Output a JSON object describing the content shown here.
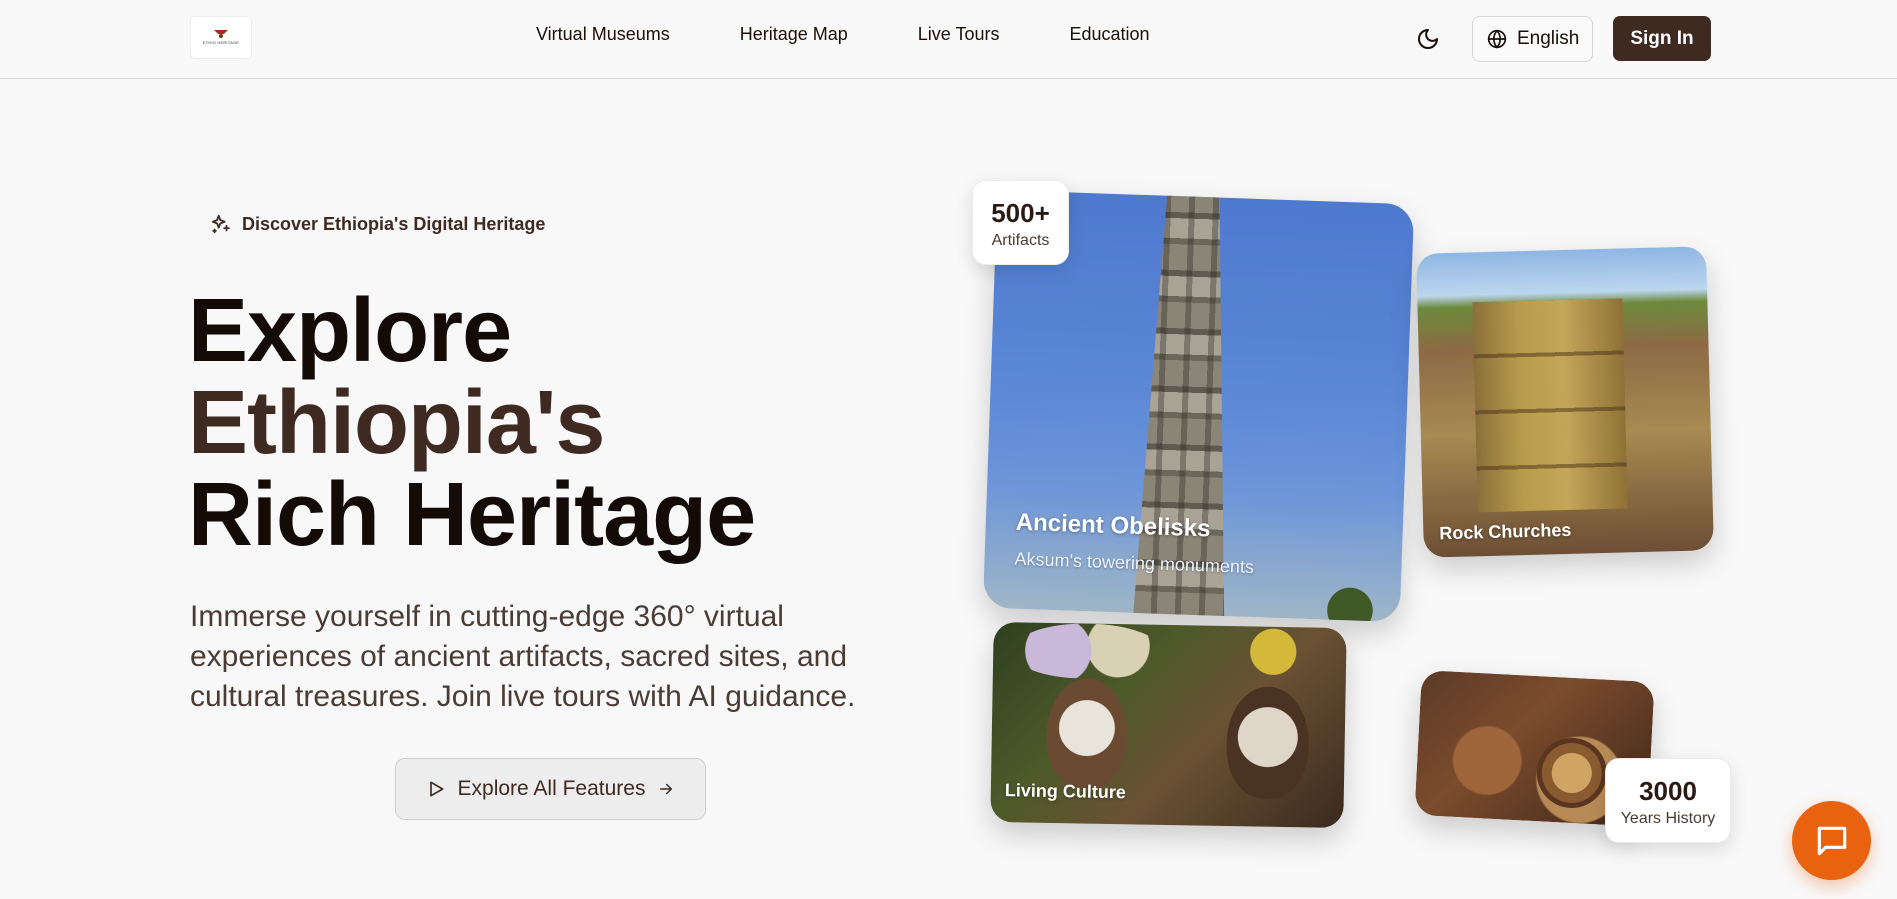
{
  "header": {
    "logo_text": "ETHIO HERITAGE",
    "nav": [
      "Virtual Museums",
      "Heritage Map",
      "Live Tours",
      "Education"
    ],
    "language": "English",
    "sign_in": "Sign In"
  },
  "hero": {
    "eyebrow": "Discover Ethiopia's Digital Heritage",
    "title_line1": "Explore",
    "title_line2": "Ethiopia's",
    "title_line3": "Rich Heritage",
    "description": "Immerse yourself in cutting-edge 360° virtual experiences of ancient artifacts, sacred sites, and cultural treasures. Join live tours with AI guidance.",
    "cta_label": "Explore All Features"
  },
  "cards": {
    "main": {
      "title": "Ancient Obelisks",
      "subtitle": "Aksum's towering monuments"
    },
    "rock": {
      "title": "Rock Churches"
    },
    "culture": {
      "title": "Living Culture"
    }
  },
  "stats": {
    "artifacts": {
      "value": "500+",
      "label": "Artifacts"
    },
    "history": {
      "value": "3000",
      "label": "Years History"
    }
  },
  "colors": {
    "brand_dark": "#3f2a22",
    "accent_orange": "#e8620f",
    "background": "#f8f8f8"
  },
  "icons": [
    "sparkles-icon",
    "moon-icon",
    "globe-icon",
    "play-icon",
    "arrow-right-icon",
    "chat-icon"
  ]
}
